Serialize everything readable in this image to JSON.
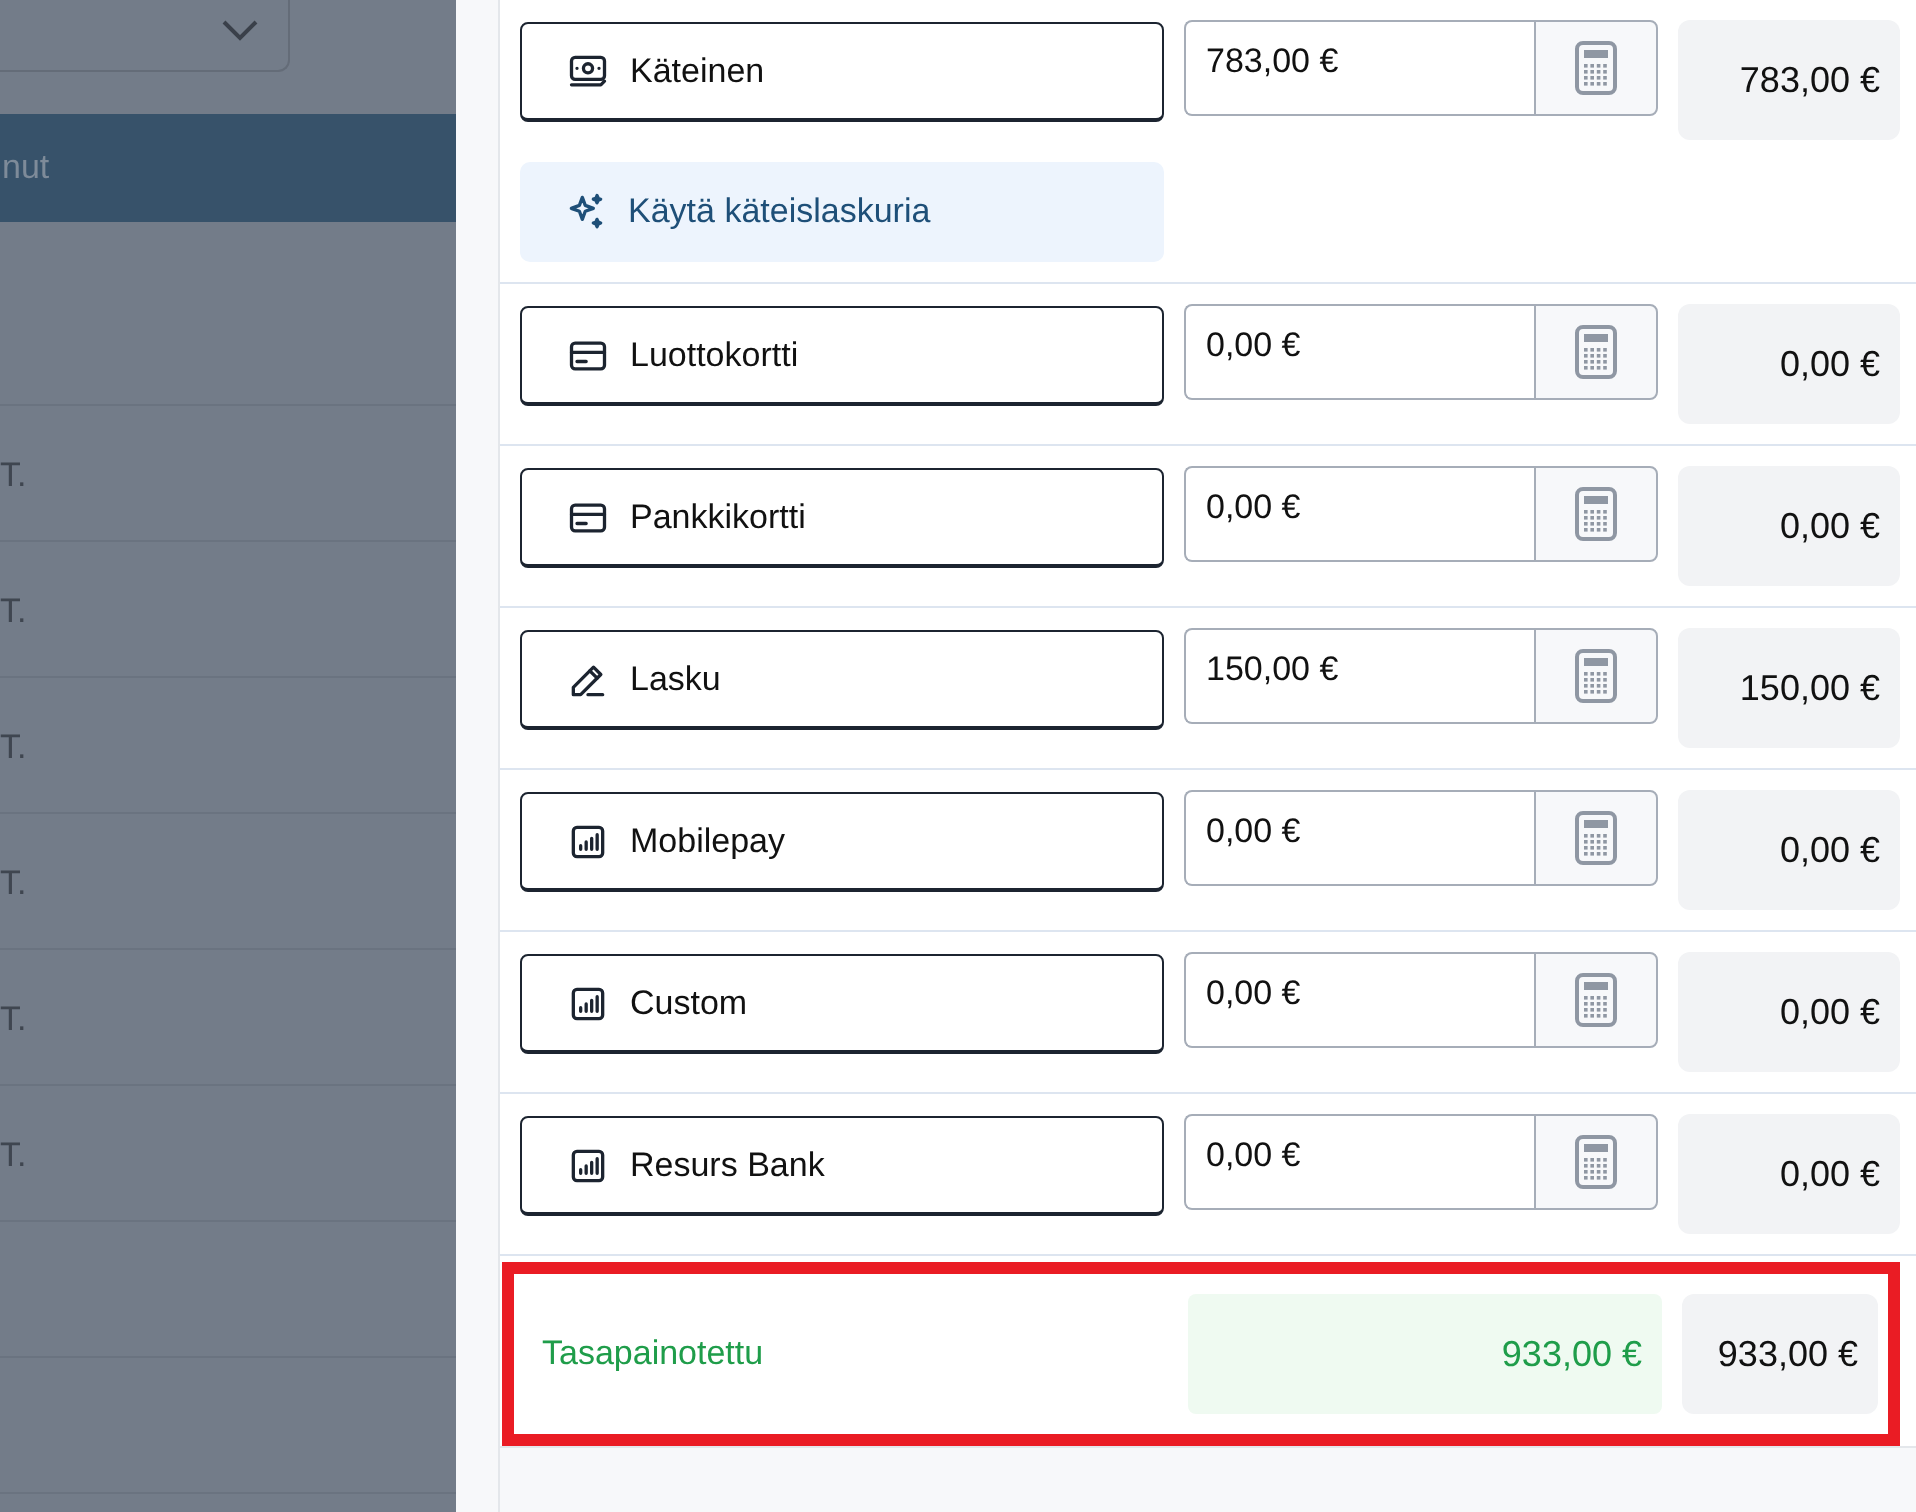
{
  "backdrop": {
    "header": "nut",
    "rows": [
      "T.",
      "T.",
      "T.",
      "T.",
      "T.",
      "T."
    ]
  },
  "methods": [
    {
      "kind": "cash",
      "label": "Käteinen",
      "value": "783,00 €",
      "total": "783,00 €",
      "action": "Käytä käteislaskuria"
    },
    {
      "kind": "card",
      "label": "Luottokortti",
      "value": "0,00 €",
      "total": "0,00 €"
    },
    {
      "kind": "card",
      "label": "Pankkikortti",
      "value": "0,00 €",
      "total": "0,00 €"
    },
    {
      "kind": "pen",
      "label": "Lasku",
      "value": "150,00 €",
      "total": "150,00 €"
    },
    {
      "kind": "chart",
      "label": "Mobilepay",
      "value": "0,00 €",
      "total": "0,00 €"
    },
    {
      "kind": "chart",
      "label": "Custom",
      "value": "0,00 €",
      "total": "0,00 €"
    },
    {
      "kind": "chart",
      "label": "Resurs Bank",
      "value": "0,00 €",
      "total": "0,00 €"
    }
  ],
  "balance": {
    "label": "Tasapainotettu",
    "difference": "933,00 €",
    "total": "933,00 €",
    "highlighted": true
  }
}
